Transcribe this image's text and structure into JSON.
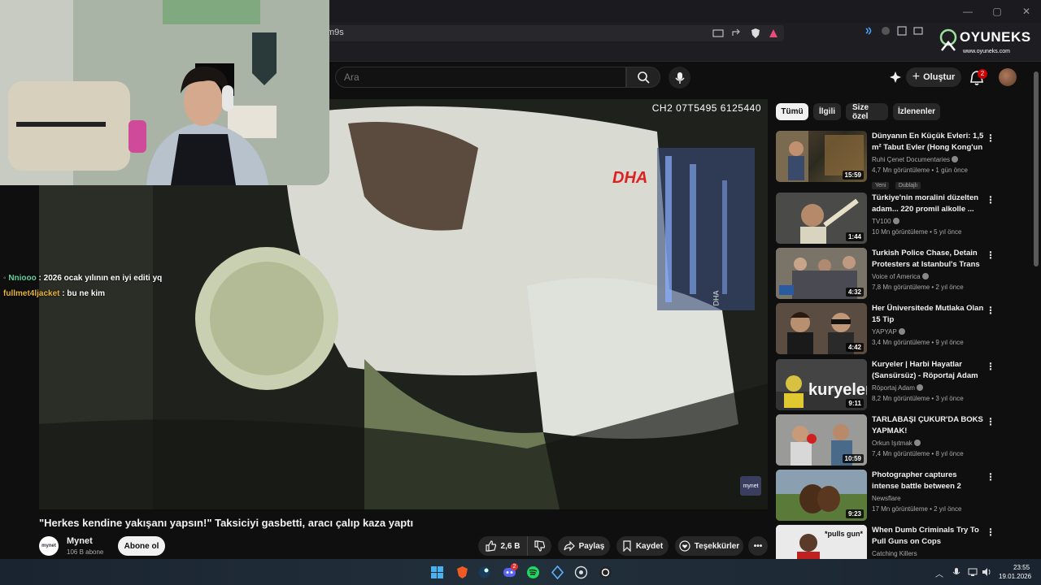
{
  "browser": {
    "url_fragment": "m9s",
    "window_controls": [
      "—",
      "▢",
      "✕"
    ]
  },
  "logo": {
    "name": "OYUNEKS",
    "url": "www.oyuneks.com"
  },
  "youtube": {
    "search_placeholder": "Ara",
    "create_label": "Oluştur",
    "notification_count": "2"
  },
  "player": {
    "code": "CH2 07T5495 6125440",
    "watermark": "DHA",
    "watermark_side": "DHA",
    "corner_logo": "mynet"
  },
  "chat": [
    {
      "user": "Nniooo",
      "message": ": 2026 ocak yılının en iyi editi yq"
    },
    {
      "user": "fullmet4ljacket",
      "message": ": bu ne kim"
    }
  ],
  "video": {
    "title": "\"Herkes kendine yakışanı yapsın!\" Taksiciyi gasbetti, aracı çalıp kaza yaptı",
    "channel": "Mynet",
    "channel_avatar": "mynet",
    "subscribers": "106 B abone",
    "subscribe_label": "Abone ol",
    "likes": "2,6 B",
    "share_label": "Paylaş",
    "save_label": "Kaydet",
    "thanks_label": "Teşekkürler",
    "more_label": "•••"
  },
  "chips": [
    "Tümü",
    "İlgili",
    "Size özel",
    "İzlenenler"
  ],
  "recommendations": [
    {
      "title": "Dünyanın En Küçük Evleri: 1,5 m² Tabut Evler (Hong Kong'un ...",
      "channel": "Ruhi Çenet Documentaries",
      "meta": "4,7 Mn görüntüleme • 1 gün önce",
      "duration": "15:59",
      "tags": [
        "Yeni",
        "Dublajlı"
      ]
    },
    {
      "title": "Türkiye'nin moralini düzelten adam... 220 promil alkolle ...",
      "channel": "TV100",
      "meta": "10 Mn görüntüleme • 5 yıl önce",
      "duration": "1:44"
    },
    {
      "title": "Turkish Police Chase, Detain Protesters at Istanbul's Trans ...",
      "channel": "Voice of America",
      "meta": "7,8 Mn görüntüleme • 2 yıl önce",
      "duration": "4:32"
    },
    {
      "title": "Her Üniversitede Mutlaka Olan 15 Tip",
      "channel": "YAPYAP",
      "meta": "3,4 Mn görüntüleme • 9 yıl önce",
      "duration": "4:42"
    },
    {
      "title": "Kuryeler | Harbi Hayatlar (Sansürsüz) - Röportaj Adam",
      "channel": "Röportaj Adam",
      "meta": "8,2 Mn görüntüleme • 3 yıl önce",
      "duration": "9:11",
      "thumb_text": "kuryeler"
    },
    {
      "title": "TARLABAŞI ÇUKUR'DA BOKS YAPMAK!",
      "channel": "Orkun Işıtmak",
      "meta": "7,4 Mn görüntüleme • 8 yıl önce",
      "duration": "10:59"
    },
    {
      "title": "Photographer captures intense battle between 2 HUGE ...",
      "channel": "Newsflare",
      "meta": "17 Mn görüntüleme • 2 yıl önce",
      "duration": "9:23"
    },
    {
      "title": "When Dumb Criminals Try To Pull Guns on Cops",
      "channel": "Catching Killers",
      "meta": "",
      "duration": "",
      "thumb_text": "*pulls gun*"
    }
  ],
  "taskbar": {
    "time": "23:55",
    "date": "19.01.2026",
    "discord_badge": "2"
  },
  "colors": {
    "accent": "#cc0000",
    "background": "#0f0f0f",
    "chat_user1": "#62d0a0",
    "chat_user2": "#e7b43a"
  }
}
